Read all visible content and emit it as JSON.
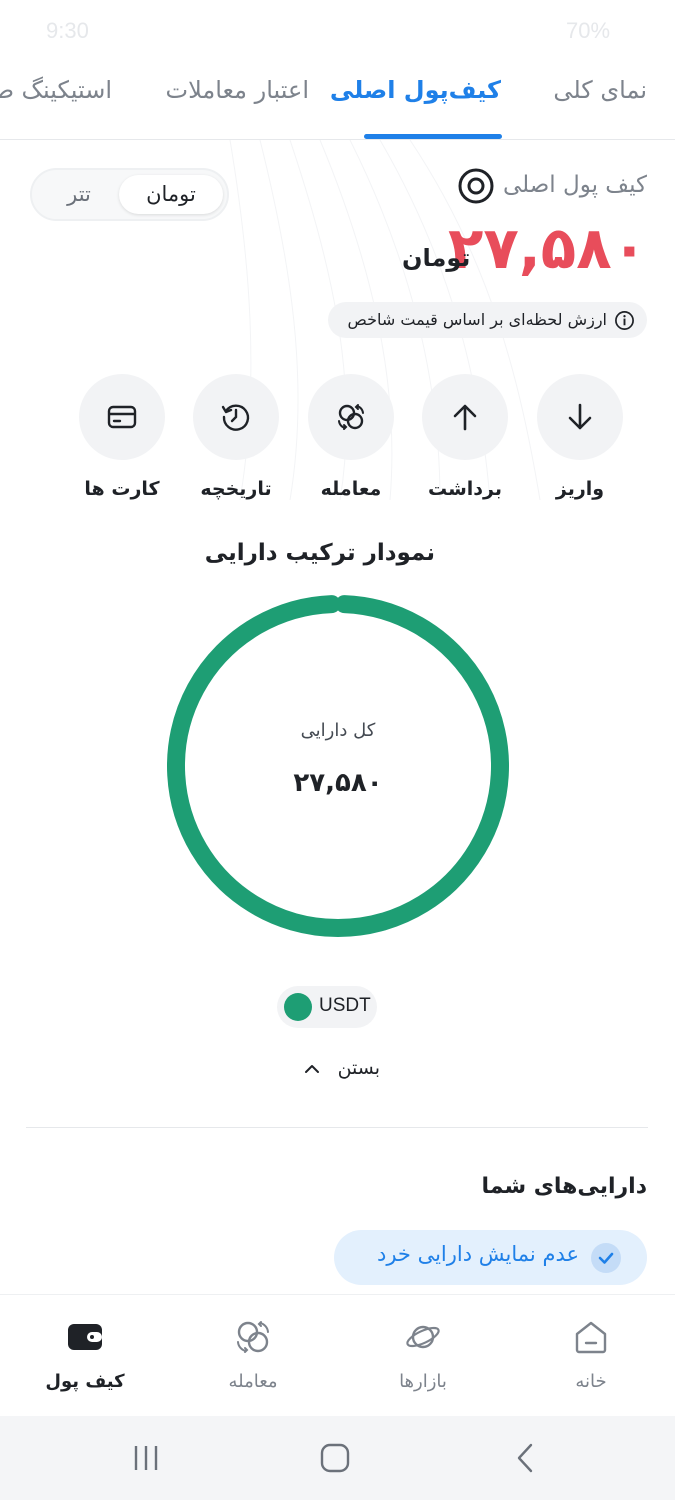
{
  "status_bar": {
    "time": "9:30",
    "battery": "70%"
  },
  "tabs": [
    {
      "label": "نمای کلی",
      "active": false
    },
    {
      "label": "کیف‌پول اصلی",
      "active": true
    },
    {
      "label": "اعتبار معاملات",
      "active": false
    },
    {
      "label": "استیکینگ ط",
      "active": false
    }
  ],
  "wallet": {
    "title": "کیف پول اصلی",
    "balance": "۲۷,۵۸۰",
    "unit": "تومان",
    "price_note": "ارزش لحظه‌ای بر اساس قیمت شاخص",
    "currency_options": {
      "active": "تومان",
      "inactive": "تتر"
    }
  },
  "actions": [
    {
      "label": "واریز",
      "icon": "arrow-down-icon"
    },
    {
      "label": "برداشت",
      "icon": "arrow-up-icon"
    },
    {
      "label": "معامله",
      "icon": "exchange-icon"
    },
    {
      "label": "تاریخچه",
      "icon": "history-icon"
    },
    {
      "label": "کارت ها",
      "icon": "card-icon"
    }
  ],
  "composition": {
    "title": "نمودار ترکیب دارایی",
    "center_label": "کل دارایی",
    "center_value": "۲۷,۵۸۰",
    "legend": [
      {
        "name": "USDT",
        "color": "#1e9e74",
        "share": 1.0
      }
    ],
    "collapse_label": "بستن"
  },
  "assets": {
    "title": "دارایی‌های شما",
    "hide_small_label": "عدم نمایش دارایی خرد"
  },
  "bottom_nav": [
    {
      "label": "خانه",
      "icon": "home-icon",
      "active": false
    },
    {
      "label": "بازارها",
      "icon": "planet-icon",
      "active": false
    },
    {
      "label": "معامله",
      "icon": "exchange-icon",
      "active": false
    },
    {
      "label": "کیف پول",
      "icon": "wallet-icon",
      "active": true
    }
  ],
  "colors": {
    "accent": "#1f80e8",
    "balance": "#e84d5b",
    "usdt": "#1e9e74"
  }
}
